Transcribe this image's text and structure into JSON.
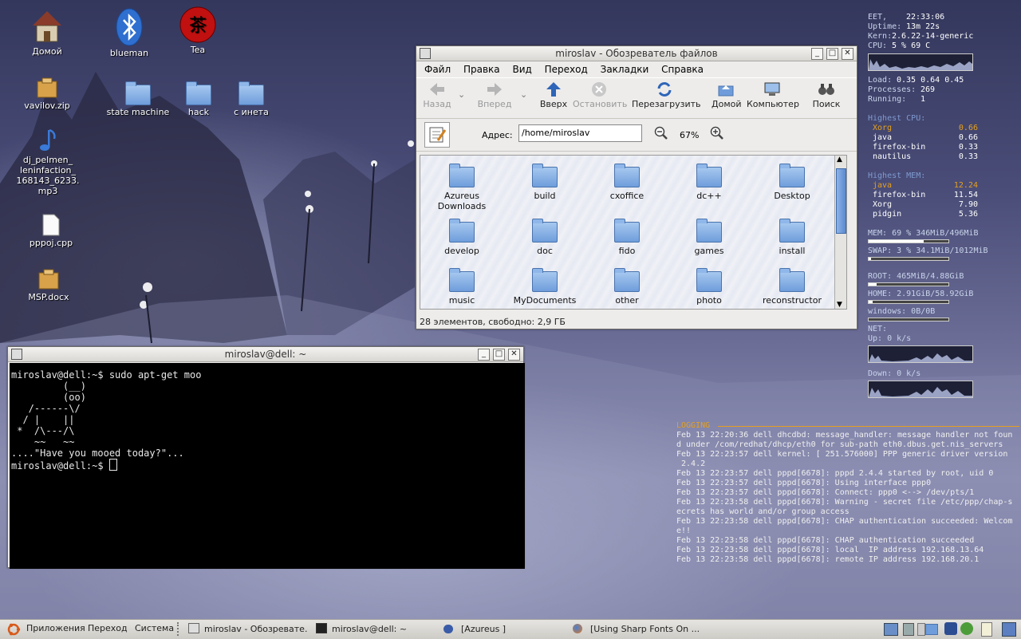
{
  "desktop": {
    "icons": [
      {
        "label": "Домой"
      },
      {
        "label": "blueman"
      },
      {
        "label": "Tea"
      },
      {
        "label": "vavilov.zip"
      },
      {
        "label": "state machine"
      },
      {
        "label": "hack"
      },
      {
        "label": "с инета"
      },
      {
        "label": "dj_pelmen_ leninfaction_ 168143_6233. mp3"
      },
      {
        "label": "pppoj.cpp"
      },
      {
        "label": "MSP.docx"
      }
    ]
  },
  "file_browser": {
    "title": "miroslav - Обозреватель файлов",
    "menu": [
      "Файл",
      "Правка",
      "Вид",
      "Переход",
      "Закладки",
      "Справка"
    ],
    "toolbar": {
      "back": "Назад",
      "forward": "Вперед",
      "up": "Вверх",
      "stop": "Остановить",
      "reload": "Перезагрузить",
      "home": "Домой",
      "computer": "Компьютер",
      "search": "Поиск"
    },
    "address_label": "Адрес:",
    "address_value": "/home/miroslav",
    "zoom": "67%",
    "items": [
      "Azureus Downloads",
      "build",
      "cxoffice",
      "dc++",
      "Desktop",
      "develop",
      "doc",
      "fido",
      "games",
      "install",
      "music",
      "MyDocuments",
      "other",
      "photo",
      "reconstructor"
    ],
    "status": "28 элементов, свободно: 2,9 ГБ"
  },
  "terminal": {
    "title": "miroslav@dell: ~",
    "lines": [
      "miroslav@dell:~$ sudo apt-get moo",
      "         (__)",
      "         (oo)",
      "   /------\\/",
      "  / |    ||",
      " *  /\\---/\\",
      "    ~~   ~~",
      "....\"Have you mooed today?\"...",
      "miroslav@dell:~$ "
    ]
  },
  "conky": {
    "eet_label": "EET,",
    "eet_value": "22:33:06",
    "uptime_label": "Uptime:",
    "uptime_value": "13m 22s",
    "kern_label": "Kern:",
    "kern_value": "2.6.22-14-generic",
    "cpu_label": "CPU:",
    "cpu_value": "5  % 69  C",
    "load_label": "Load:",
    "load_value": "0.35 0.64 0.45",
    "proc_label": "Processes:",
    "proc_value": "269",
    "run_label": "Running:",
    "run_value": "1",
    "highest_cpu": "Highest CPU:",
    "cpu_procs": [
      {
        "name": "Xorg",
        "val": "0.66"
      },
      {
        "name": "java",
        "val": "0.66"
      },
      {
        "name": "firefox-bin",
        "val": "0.33"
      },
      {
        "name": "nautilus",
        "val": "0.33"
      }
    ],
    "highest_mem": "Highest MEM:",
    "mem_procs": [
      {
        "name": "java",
        "val": "12.24"
      },
      {
        "name": "firefox-bin",
        "val": "11.54"
      },
      {
        "name": "Xorg",
        "val": "7.90"
      },
      {
        "name": "pidgin",
        "val": "5.36"
      }
    ],
    "mem_line": "MEM:    69 % 346MiB/496MiB",
    "swap_line": "SWAP: 3  % 34.1MiB/1012MiB",
    "root_line": "ROOT:     465MiB/4.88GiB",
    "home_line": "HOME:  2.91GiB/58.92GiB",
    "windows_line": "windows:   0B/0B",
    "net_label": "NET:",
    "up_line": "Up: 0     k/s",
    "down_line": "Down: 0    k/s",
    "mem_fraction": 0.69,
    "swap_fraction": 0.03,
    "root_fraction": 0.1,
    "home_fraction": 0.05
  },
  "log": {
    "header": "LOGGING",
    "lines": [
      "Feb 13 22:20:36 dell dhcdbd: message_handler: message handler not foun",
      "d under /com/redhat/dhcp/eth0 for sub-path eth0.dbus.get.nis_servers",
      "Feb 13 22:23:57 dell kernel: [  251.576000] PPP generic driver version",
      " 2.4.2",
      "Feb 13 22:23:57 dell pppd[6678]: pppd 2.4.4 started by root, uid 0",
      "Feb 13 22:23:57 dell pppd[6678]: Using interface ppp0",
      "Feb 13 22:23:57 dell pppd[6678]: Connect: ppp0 <--> /dev/pts/1",
      "Feb 13 22:23:58 dell pppd[6678]: Warning - secret file /etc/ppp/chap-s",
      "ecrets has world and/or group access",
      "Feb 13 22:23:58 dell pppd[6678]: CHAP authentication succeeded: Welcom",
      "e!!",
      "Feb 13 22:23:58 dell pppd[6678]: CHAP authentication succeeded",
      "Feb 13 22:23:58 dell pppd[6678]: local  IP address 192.168.13.64",
      "Feb 13 22:23:58 dell pppd[6678]: remote IP address 192.168.20.1"
    ]
  },
  "taskbar": {
    "apps": "Приложения",
    "places": "Переход",
    "system": "Система",
    "tasks": [
      "miroslav - Обозревате...",
      "miroslav@dell: ~",
      "[Azureus ]",
      "[Using Sharp Fonts On ..."
    ]
  },
  "colors": {
    "accent_orange": "#e4a020",
    "folder_blue": "#6f9ddb"
  }
}
